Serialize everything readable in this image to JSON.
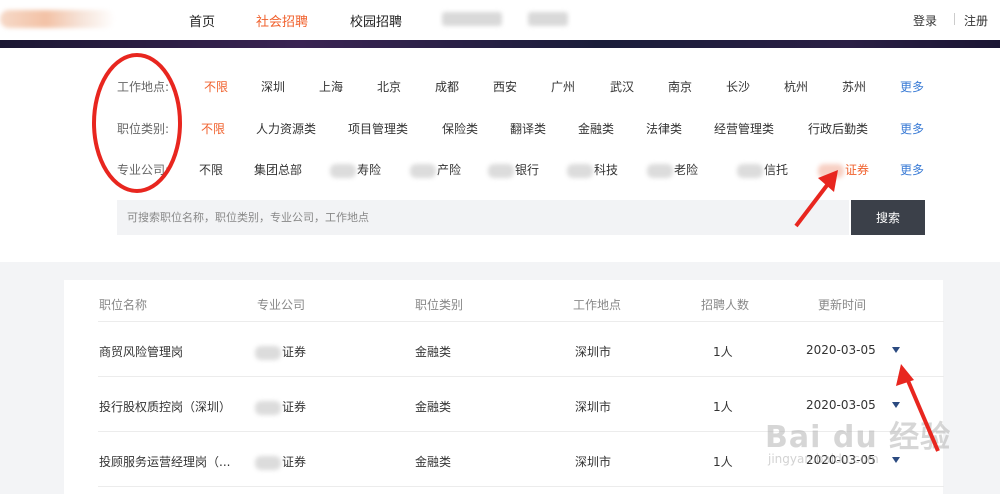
{
  "nav": {
    "items": [
      {
        "label": "首页"
      },
      {
        "label": "社会招聘"
      },
      {
        "label": "校园招聘"
      }
    ],
    "login": "登录",
    "register": "注册"
  },
  "filters": {
    "location": {
      "label": "工作地点:",
      "options": [
        "不限",
        "深圳",
        "上海",
        "北京",
        "成都",
        "西安",
        "广州",
        "武汉",
        "南京",
        "长沙",
        "杭州",
        "苏州"
      ],
      "more": "更多"
    },
    "category": {
      "label": "职位类别:",
      "options": [
        "不限",
        "人力资源类",
        "项目管理类",
        "保险类",
        "翻译类",
        "金融类",
        "法律类",
        "经营管理类",
        "行政后勤类"
      ],
      "more": "更多"
    },
    "company": {
      "label": "专业公司:",
      "options": [
        "不限",
        "集团总部",
        "寿险",
        "产险",
        "银行",
        "科技",
        "老险",
        "信托",
        "证券"
      ],
      "more": "更多"
    }
  },
  "search": {
    "placeholder": "可搜索职位名称，职位类别，专业公司，工作地点",
    "button": "搜索"
  },
  "table": {
    "headers": [
      "职位名称",
      "专业公司",
      "职位类别",
      "工作地点",
      "招聘人数",
      "更新时间"
    ],
    "rows": [
      {
        "title": "商贸风险管理岗",
        "company": "证券",
        "category": "金融类",
        "location": "深圳市",
        "count": "1人",
        "date": "2020-03-05"
      },
      {
        "title": "投行股权质控岗（深圳）",
        "company": "证券",
        "category": "金融类",
        "location": "深圳市",
        "count": "1人",
        "date": "2020-03-05"
      },
      {
        "title": "投顾服务运营经理岗（...",
        "company": "证券",
        "category": "金融类",
        "location": "深圳市",
        "count": "1人",
        "date": "2020-03-05"
      }
    ]
  },
  "watermark": {
    "main": "Bai du 经验",
    "sub": "jingyan.baidu.com"
  },
  "colors": {
    "accent": "#f0602c",
    "link": "#3a7bd5",
    "annotation": "#e8261f",
    "button": "#3b4049"
  }
}
